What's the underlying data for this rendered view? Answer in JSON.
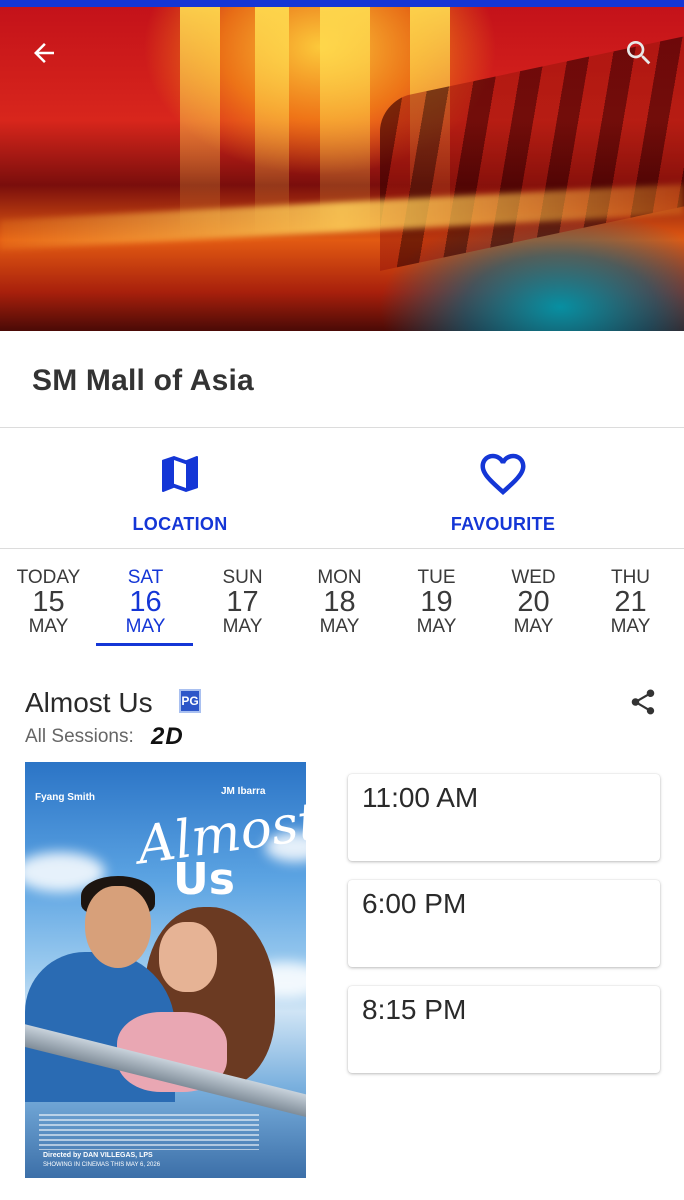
{
  "header": {
    "back_icon": "arrow-left-icon",
    "search_icon": "search-icon"
  },
  "cinema": {
    "name": "SM Mall of Asia"
  },
  "actions": [
    {
      "label": "LOCATION",
      "icon": "map-icon"
    },
    {
      "label": "FAVOURITE",
      "icon": "heart-outline-icon"
    }
  ],
  "dates": [
    {
      "day": "TODAY",
      "num": "15",
      "month": "MAY",
      "selected": false
    },
    {
      "day": "SAT",
      "num": "16",
      "month": "MAY",
      "selected": true
    },
    {
      "day": "SUN",
      "num": "17",
      "month": "MAY",
      "selected": false
    },
    {
      "day": "MON",
      "num": "18",
      "month": "MAY",
      "selected": false
    },
    {
      "day": "TUE",
      "num": "19",
      "month": "MAY",
      "selected": false
    },
    {
      "day": "WED",
      "num": "20",
      "month": "MAY",
      "selected": false
    },
    {
      "day": "THU",
      "num": "21",
      "month": "MAY",
      "selected": false
    }
  ],
  "movie": {
    "title": "Almost Us",
    "rating": "PG",
    "sessions_label": "All Sessions:",
    "format": "2D",
    "share_icon": "share-icon",
    "poster": {
      "actor_left": "Fyang Smith",
      "actor_right": "JM Ibarra",
      "title_line1": "Almost",
      "title_line2": "Us",
      "director": "Directed by DAN VILLEGAS, LPS",
      "showing": "SHOWING IN CINEMAS THIS MAY 6, 2026"
    },
    "sessions": [
      "11:00 AM",
      "6:00 PM",
      "8:15 PM"
    ]
  },
  "colors": {
    "accent": "#1436d6",
    "rating_badge": "#2d56c8"
  }
}
